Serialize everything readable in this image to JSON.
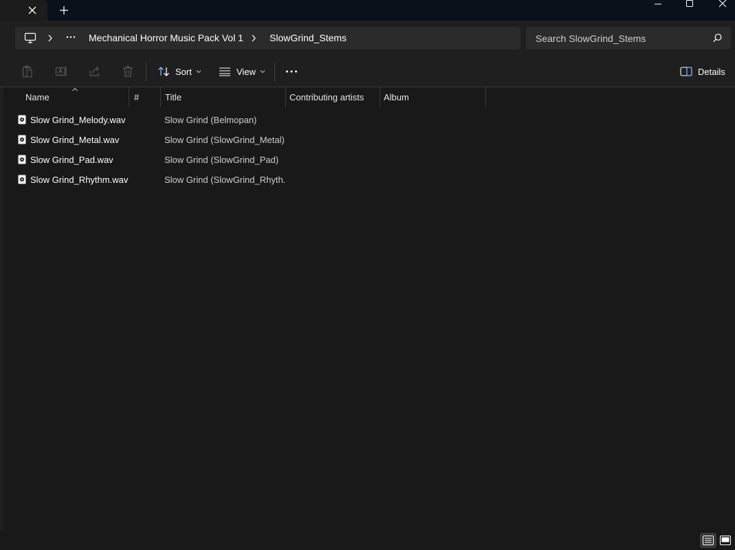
{
  "window": {
    "tab_close_icon": "close-icon",
    "new_tab_icon": "plus-icon",
    "controls": [
      "minimize-icon",
      "maximize-icon",
      "close-icon"
    ]
  },
  "address": {
    "root_icon": "monitor-icon",
    "crumbs": [
      "Mechanical Horror Music Pack Vol 1",
      "SlowGrind_Stems"
    ]
  },
  "search": {
    "placeholder": "Search SlowGrind_Stems"
  },
  "toolbar": {
    "sort_label": "Sort",
    "view_label": "View",
    "details_label": "Details"
  },
  "columns": {
    "name": "Name",
    "number": "#",
    "title": "Title",
    "artists": "Contributing artists",
    "album": "Album"
  },
  "files": [
    {
      "name": "Slow Grind_Melody.wav",
      "title": "Slow Grind (Belmopan)"
    },
    {
      "name": "Slow Grind_Metal.wav",
      "title": "Slow Grind (SlowGrind_Metal)"
    },
    {
      "name": "Slow Grind_Pad.wav",
      "title": "Slow Grind (SlowGrind_Pad)"
    },
    {
      "name": "Slow Grind_Rhythm.wav",
      "title": "Slow Grind (SlowGrind_Rhyth..."
    }
  ],
  "status": {
    "active_view": "details"
  }
}
